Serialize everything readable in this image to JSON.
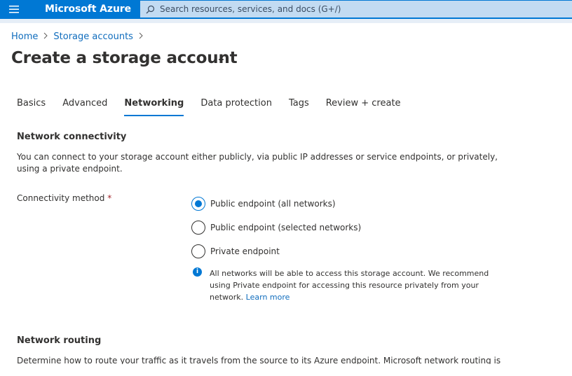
{
  "topbar": {
    "menu_icon": "hamburger-icon",
    "brand": "Microsoft Azure",
    "search_placeholder": "Search resources, services, and docs (G+/)",
    "search_icon": "search-icon",
    "colors": {
      "bar": "#0078d4",
      "search_bg": "#c2dbf2"
    }
  },
  "breadcrumb": {
    "items": [
      "Home",
      "Storage accounts"
    ],
    "separator_icon": "chevron-right-icon"
  },
  "page": {
    "title": "Create a storage account",
    "more_icon": "ellipsis-icon"
  },
  "tabs": [
    {
      "label": "Basics",
      "active": false
    },
    {
      "label": "Advanced",
      "active": false
    },
    {
      "label": "Networking",
      "active": true
    },
    {
      "label": "Data protection",
      "active": false
    },
    {
      "label": "Tags",
      "active": false
    },
    {
      "label": "Review + create",
      "active": false
    }
  ],
  "network_connectivity": {
    "title": "Network connectivity",
    "description": "You can connect to your storage account either publicly, via public IP addresses or service endpoints, or privately, using a private endpoint.",
    "field_label": "Connectivity method",
    "required_mark": "*",
    "options": [
      {
        "label": "Public endpoint (all networks)",
        "selected": true
      },
      {
        "label": "Public endpoint (selected networks)",
        "selected": false
      },
      {
        "label": "Private endpoint",
        "selected": false
      }
    ],
    "info": {
      "icon": "info-icon",
      "text": "All networks will be able to access this storage account. We recommend using Private endpoint for accessing this resource privately from your network.",
      "link": "Learn more"
    }
  },
  "network_routing": {
    "title": "Network routing",
    "description": "Determine how to route your traffic as it travels from the source to its Azure endpoint. Microsoft network routing is"
  },
  "accent_color": "#0078d4"
}
